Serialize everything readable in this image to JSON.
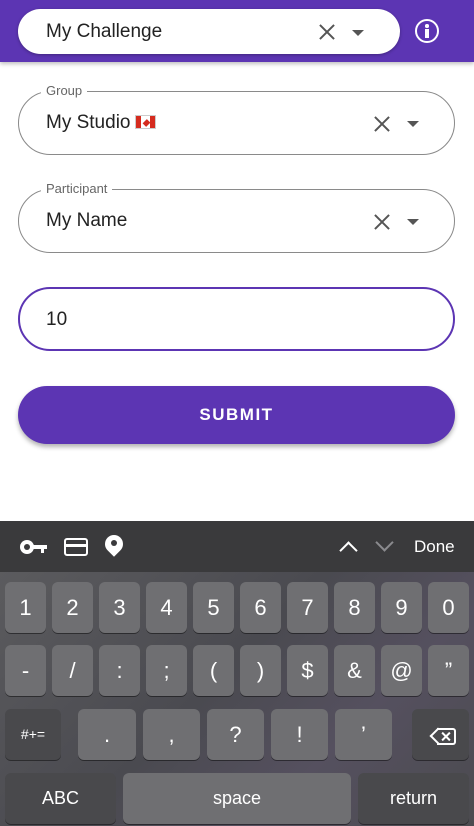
{
  "header": {
    "challenge_value": "My Challenge"
  },
  "form": {
    "group": {
      "label": "Group",
      "value": "My Studio",
      "flag": "canada-flag"
    },
    "participant": {
      "label": "Participant",
      "value": "My Name"
    },
    "amount": {
      "value": "10"
    },
    "submit_label": "SUBMIT"
  },
  "accessory": {
    "done_label": "Done"
  },
  "keyboard": {
    "row1": [
      "1",
      "2",
      "3",
      "4",
      "5",
      "6",
      "7",
      "8",
      "9",
      "0"
    ],
    "row2": [
      "-",
      "/",
      ":",
      ";",
      "(",
      ")",
      "$",
      "&",
      "@",
      "”"
    ],
    "row3": [
      "#+=",
      ".",
      ",",
      "?",
      "!",
      "’"
    ],
    "abc_label": "ABC",
    "space_label": "space",
    "return_label": "return"
  },
  "colors": {
    "primary": "#5c35b3",
    "keyboard_bg": "#4f4f53"
  }
}
